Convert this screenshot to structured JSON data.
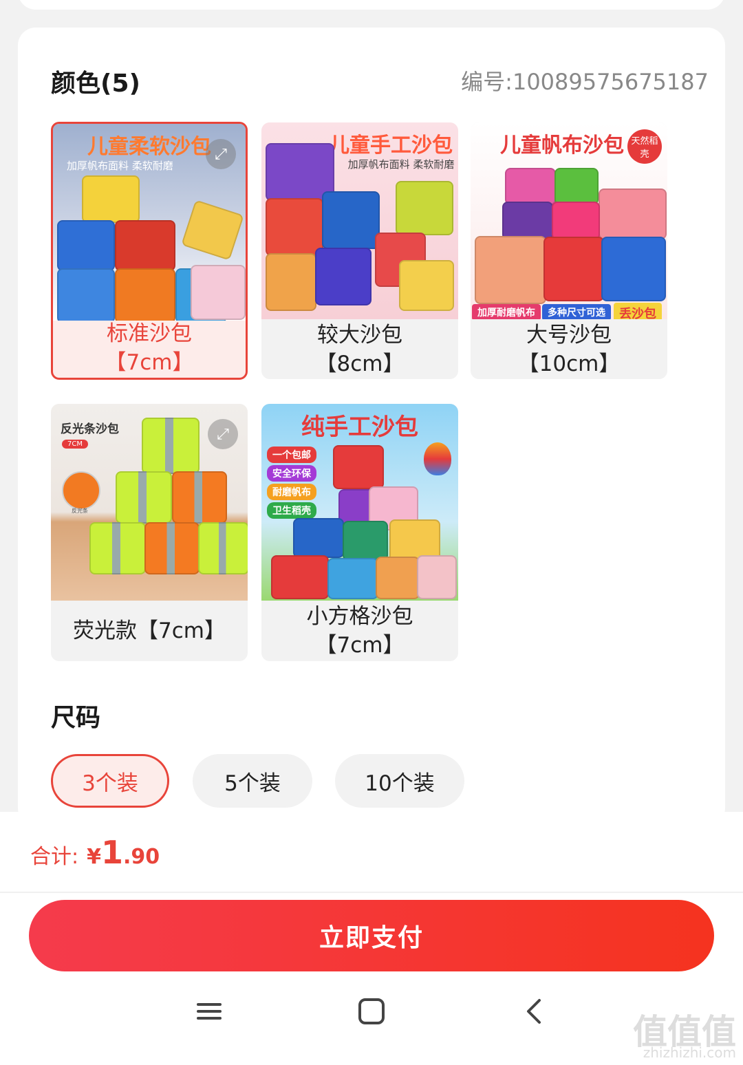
{
  "color_section": {
    "title": "颜色(5)",
    "sku_code": "编号:10089575675187",
    "options": [
      {
        "label": "标准沙包\n【7cm】",
        "thumb_title": "儿童柔软沙包",
        "thumb_sub": "加厚帆布面料 柔软耐磨",
        "selected": true
      },
      {
        "label": "较大沙包\n【8cm】",
        "thumb_title": "儿童手工沙包",
        "thumb_sub": "加厚帆布面料 柔软耐磨",
        "selected": false
      },
      {
        "label": "大号沙包\n【10cm】",
        "thumb_title": "儿童帆布沙包",
        "thumb_badge": "天然稻壳",
        "thumb_tags": [
          "加厚耐磨帆布",
          "多种尺寸可选",
          "丢沙包"
        ],
        "selected": false
      },
      {
        "label": "荧光款【7cm】",
        "thumb_title": "反光条沙包",
        "thumb_badge": "7CM",
        "thumb_note": "反光条",
        "selected": false
      },
      {
        "label": "小方格沙包\n【7cm】",
        "thumb_title": "纯手工沙包",
        "thumb_tags": [
          "一个包邮",
          "安全环保",
          "耐磨帆布",
          "卫生稻壳"
        ],
        "selected": false
      }
    ]
  },
  "size_section": {
    "title": "尺码",
    "options": [
      {
        "label": "3个装",
        "selected": true
      },
      {
        "label": "5个装",
        "selected": false
      },
      {
        "label": "10个装",
        "selected": false
      }
    ]
  },
  "checkout": {
    "total_label": "合计:",
    "currency": "¥",
    "price_int": "1",
    "price_dec": ".90",
    "pay_button": "立即支付"
  },
  "watermark": {
    "text": "值值值",
    "url": "zhizhizhi.com"
  },
  "colors": {
    "accent": "#e8443a",
    "pay_gradient_start": "#f53b4c",
    "pay_gradient_end": "#f5331f"
  }
}
